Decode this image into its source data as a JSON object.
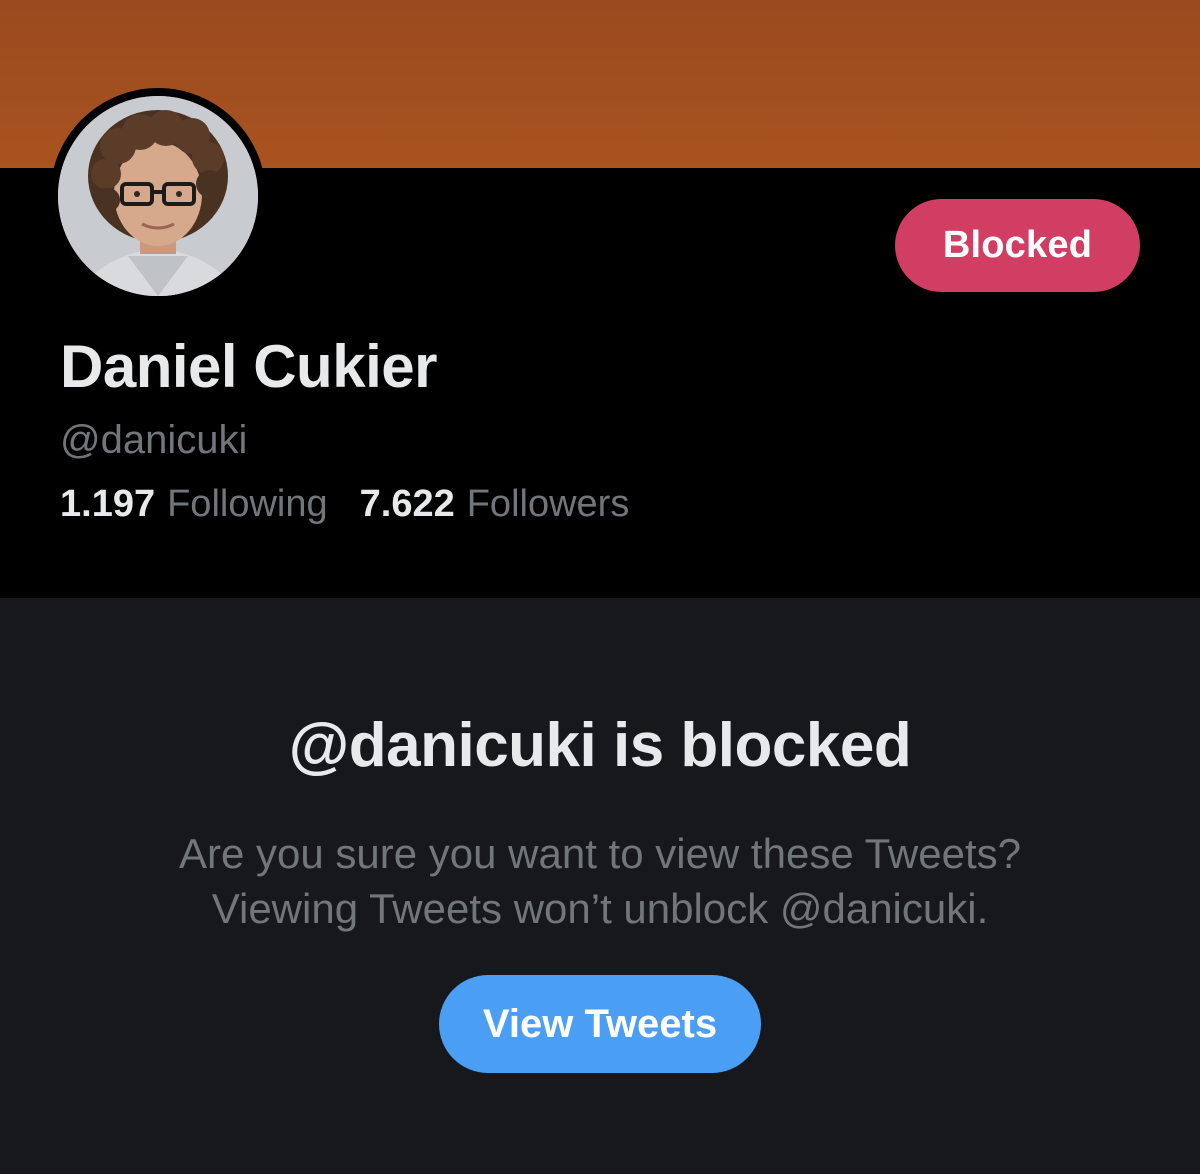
{
  "profile": {
    "display_name": "Daniel Cukier",
    "handle": "@danicuki",
    "blocked_button_label": "Blocked",
    "following_count": "1.197",
    "following_label": "Following",
    "followers_count": "7.622",
    "followers_label": "Followers"
  },
  "blocked_notice": {
    "title": "@danicuki is blocked",
    "line1": "Are you sure you want to view these Tweets?",
    "line2": "Viewing Tweets won’t unblock @danicuki.",
    "view_button_label": "View Tweets"
  },
  "colors": {
    "banner": "#a24f20",
    "blocked_button": "#d23d63",
    "view_button": "#4a9ff5",
    "profile_bg": "#000000",
    "panel_bg": "#16181c"
  }
}
